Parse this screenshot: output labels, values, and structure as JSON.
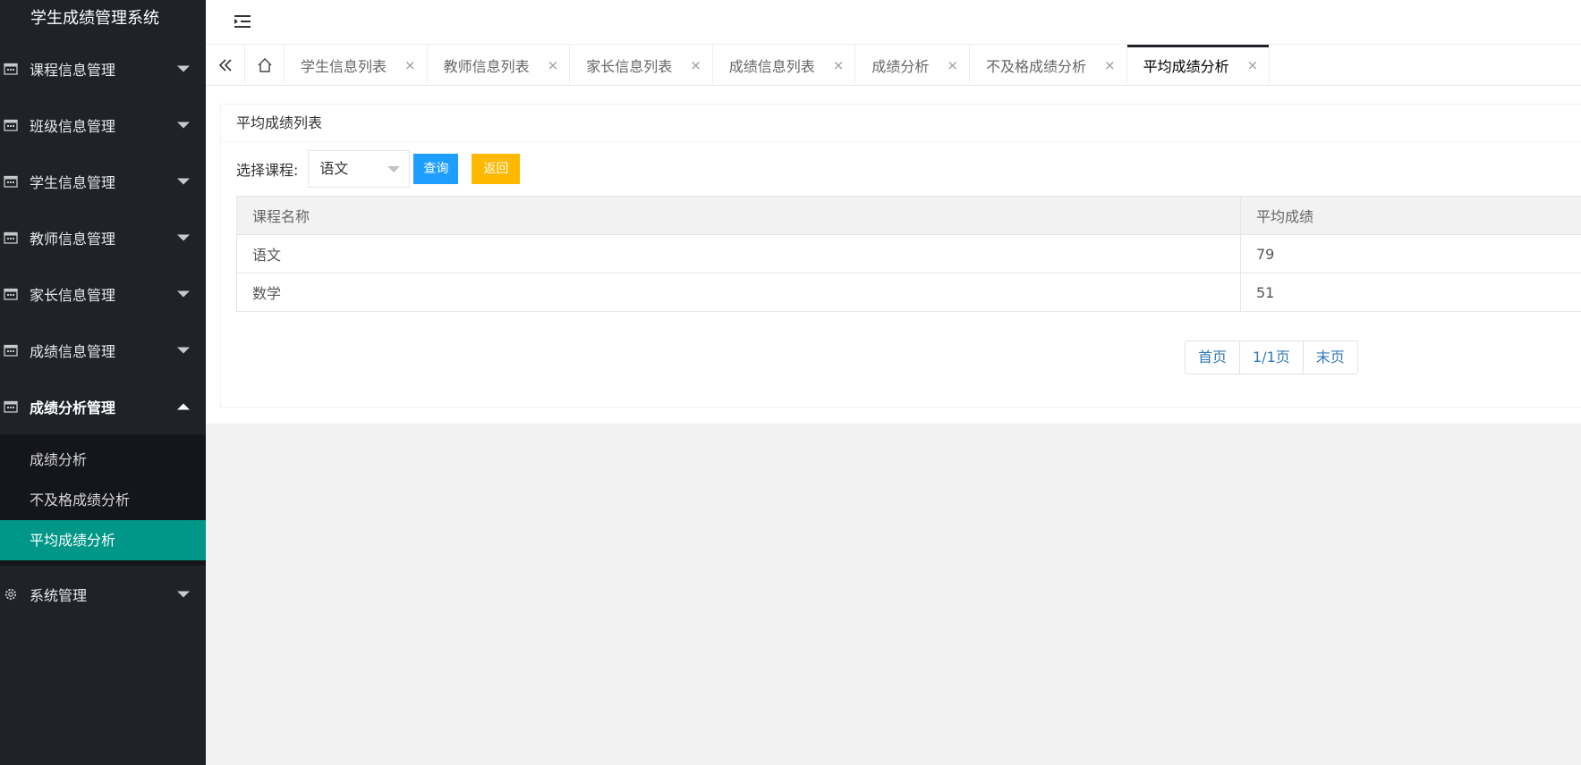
{
  "app": {
    "title": "学生成绩管理系统"
  },
  "sidebar": {
    "items": [
      {
        "label": "课程信息管理",
        "icon": "calendar-icon",
        "open": false
      },
      {
        "label": "班级信息管理",
        "icon": "calendar-icon",
        "open": false
      },
      {
        "label": "学生信息管理",
        "icon": "calendar-icon",
        "open": false
      },
      {
        "label": "教师信息管理",
        "icon": "calendar-icon",
        "open": false
      },
      {
        "label": "家长信息管理",
        "icon": "calendar-icon",
        "open": false
      },
      {
        "label": "成绩信息管理",
        "icon": "calendar-icon",
        "open": false
      },
      {
        "label": "成绩分析管理",
        "icon": "calendar-icon",
        "open": true
      },
      {
        "label": "系统管理",
        "icon": "gear-icon",
        "open": false
      }
    ],
    "submenu": [
      {
        "label": "成绩分析",
        "active": false
      },
      {
        "label": "不及格成绩分析",
        "active": false
      },
      {
        "label": "平均成绩分析",
        "active": true
      }
    ],
    "active_color": "#009688",
    "bg_color": "#20222a"
  },
  "header": {
    "fold_icon": "menu-fold-icon"
  },
  "tabs": {
    "icons": [
      "double-chevron-left-icon",
      "home-icon"
    ],
    "items": [
      {
        "label": "学生信息列表",
        "active": false
      },
      {
        "label": "教师信息列表",
        "active": false
      },
      {
        "label": "家长信息列表",
        "active": false
      },
      {
        "label": "成绩信息列表",
        "active": false
      },
      {
        "label": "成绩分析",
        "active": false
      },
      {
        "label": "不及格成绩分析",
        "active": false
      },
      {
        "label": "平均成绩分析",
        "active": true
      }
    ],
    "close_glyph": "×"
  },
  "main": {
    "card_title": "平均成绩列表",
    "filter": {
      "label": "选择课程:",
      "selected": "语文",
      "query_label": "查询",
      "back_label": "返回",
      "query_color": "#1e9fff",
      "back_color": "#ffb800"
    },
    "table": {
      "headers": [
        "课程名称",
        "平均成绩"
      ],
      "rows": [
        [
          "语文",
          "79"
        ],
        [
          "数学",
          "51"
        ]
      ]
    },
    "pager": {
      "first": "首页",
      "page": "1/1页",
      "last": "末页"
    }
  }
}
